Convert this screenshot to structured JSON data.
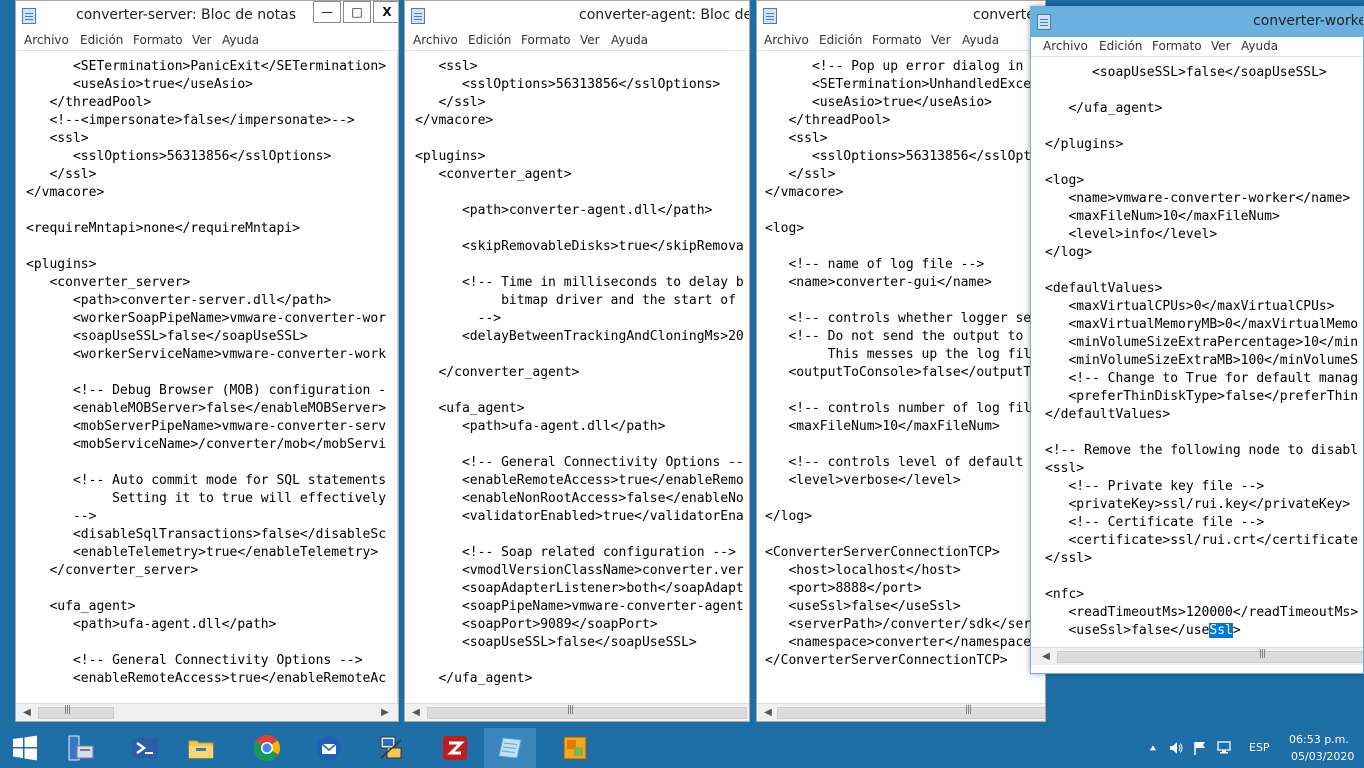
{
  "menu": [
    "Archivo",
    "Edición",
    "Formato",
    "Ver",
    "Ayuda"
  ],
  "windows": {
    "w1": {
      "title": "converter-server: Bloc de notas",
      "controls": {
        "minimize": "—",
        "maximize": "□",
        "close": "X"
      },
      "lines": [
        "      <SETermination>PanicExit</SETermination>",
        "      <useAsio>true</useAsio>",
        "   </threadPool>",
        "   <!--<impersonate>false</impersonate>-->",
        "   <ssl>",
        "      <sslOptions>56313856</sslOptions>",
        "   </ssl>",
        "</vmacore>",
        "",
        "<requireMntapi>none</requireMntapi>",
        "",
        "<plugins>",
        "   <converter_server>",
        "      <path>converter-server.dll</path>",
        "      <workerSoapPipeName>vmware-converter-wor",
        "      <soapUseSSL>false</soapUseSSL>",
        "      <workerServiceName>vmware-converter-work",
        "",
        "      <!-- Debug Browser (MOB) configuration -",
        "      <enableMOBServer>false</enableMOBServer>",
        "      <mobServerPipeName>vmware-converter-serv",
        "      <mobServiceName>/converter/mob</mobServi",
        "",
        "      <!-- Auto commit mode for SQL statements",
        "           Setting it to true will effectively",
        "      -->",
        "      <disableSqlTransactions>false</disableSc",
        "      <enableTelemetry>true</enableTelemetry>",
        "   </converter_server>",
        "",
        "   <ufa_agent>",
        "      <path>ufa-agent.dll</path>",
        "",
        "      <!-- General Connectivity Options -->",
        "      <enableRemoteAccess>true</enableRemoteAc"
      ]
    },
    "w2": {
      "title": "converter-agent: Bloc de n",
      "lines": [
        "   <ssl>",
        "      <sslOptions>56313856</sslOptions>",
        "   </ssl>",
        "</vmacore>",
        "",
        "<plugins>",
        "   <converter_agent>",
        "",
        "      <path>converter-agent.dll</path>",
        "",
        "      <skipRemovableDisks>true</skipRemova",
        "",
        "      <!-- Time in milliseconds to delay b",
        "           bitmap driver and the start of",
        "        -->",
        "      <delayBetweenTrackingAndCloningMs>20",
        "",
        "   </converter_agent>",
        "",
        "   <ufa_agent>",
        "      <path>ufa-agent.dll</path>",
        "",
        "      <!-- General Connectivity Options --",
        "      <enableRemoteAccess>true</enableRemo",
        "      <enableNonRootAccess>false</enableNo",
        "      <validatorEnabled>true</validatorEna",
        "",
        "      <!-- Soap related configuration -->",
        "      <vmodlVersionClassName>converter.ver",
        "      <soapAdapterListener>both</soapAdapt",
        "      <soapPipeName>vmware-converter-agent",
        "      <soapPort>9089</soapPort>",
        "      <soapUseSSL>false</soapUseSSL>",
        "",
        "   </ufa_agent>"
      ]
    },
    "w3": {
      "title": "converte",
      "lines": [
        "      <!-- Pop up error dialog in",
        "      <SETermination>UnhandledExce",
        "      <useAsio>true</useAsio>",
        "   </threadPool>",
        "   <ssl>",
        "      <sslOptions>56313856</sslOpt",
        "   </ssl>",
        "</vmacore>",
        "",
        "<log>",
        "",
        "   <!-- name of log file -->",
        "   <name>converter-gui</name>",
        "",
        "   <!-- controls whether logger se",
        "   <!-- Do not send the output to",
        "        This messes up the log fil",
        "   <outputToConsole>false</outputT",
        "",
        "   <!-- controls number of log fil",
        "   <maxFileNum>10</maxFileNum>",
        "",
        "   <!-- controls level of default",
        "   <level>verbose</level>",
        "",
        "</log>",
        "",
        "<ConverterServerConnectionTCP>",
        "   <host>localhost</host>",
        "   <port>8888</port>",
        "   <useSsl>false</useSsl>",
        "   <serverPath>/converter/sdk</ser",
        "   <namespace>converter</namespace",
        "</ConverterServerConnectionTCP>"
      ]
    },
    "w4": {
      "title": "converter-worker",
      "lines": [
        "      <soapUseSSL>false</soapUseSSL>",
        "",
        "   </ufa_agent>",
        "",
        "</plugins>",
        "",
        "<log>",
        "   <name>vmware-converter-worker</name>",
        "   <maxFileNum>10</maxFileNum>",
        "   <level>info</level>",
        "</log>",
        "",
        "<defaultValues>",
        "   <maxVirtualCPUs>0</maxVirtualCPUs>",
        "   <maxVirtualMemoryMB>0</maxVirtualMemo",
        "   <minVolumeSizeExtraPercentage>10</min",
        "   <minVolumeSizeExtraMB>100</minVolumeS",
        "   <!-- Change to True for default manag",
        "   <preferThinDiskType>false</preferThin",
        "</defaultValues>",
        "",
        "<!-- Remove the following node to disabl",
        "<ssl>",
        "   <!-- Private key file -->",
        "   <privateKey>ssl/rui.key</privateKey>",
        "   <!-- Certificate file -->",
        "   <certificate>ssl/rui.crt</certificate",
        "</ssl>",
        "",
        "<nfc>",
        "   <readTimeoutMs>120000</readTimeoutMs>"
      ],
      "last_line_before": "   <useSsl>false</use",
      "last_line_selected": "Ssl",
      "last_line_after": ">"
    }
  },
  "taskbar": {
    "items": [
      "start-icon",
      "server-manager-icon",
      "powershell-icon",
      "file-explorer-icon",
      "chrome-icon",
      "thunderbird-icon",
      "network-config-icon",
      "filezilla-icon",
      "notepad-icon",
      "vmware-converter-icon"
    ],
    "language": "ESP",
    "time": "06:53 p.m.",
    "date": "05/03/2020"
  },
  "colors": {
    "desktop": "#1c6ea4",
    "taskbar": "#1e6ea7",
    "active_title": "#6ab1e0",
    "selection": "#0078d7"
  }
}
